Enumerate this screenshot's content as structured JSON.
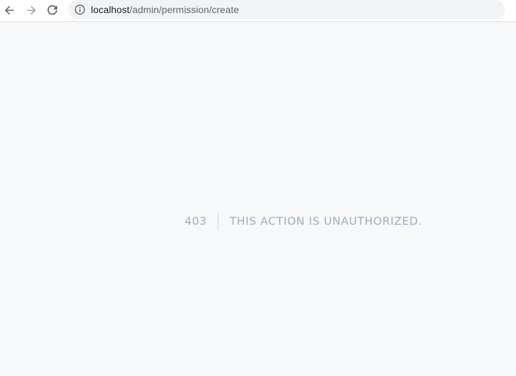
{
  "browser": {
    "back_icon": "arrow-left-icon",
    "forward_icon": "arrow-right-icon",
    "reload_icon": "reload-icon",
    "info_icon": "info-icon",
    "url_host": "localhost",
    "url_path": "/admin/permission/create"
  },
  "error": {
    "code": "403",
    "message": "THIS ACTION IS UNAUTHORIZED."
  },
  "colors": {
    "page_background": "#f7f8fa",
    "error_text": "#a0aec0",
    "omnibox_background": "#f1f3f4"
  }
}
